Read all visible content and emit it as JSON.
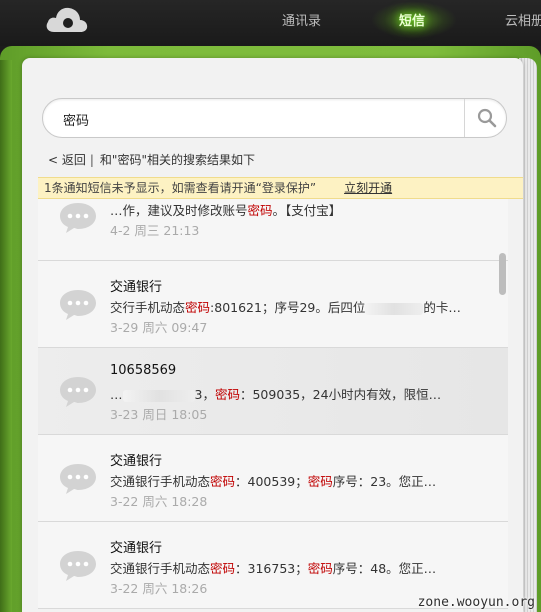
{
  "nav": {
    "items": [
      {
        "label": "通讯录"
      },
      {
        "label": "短信"
      },
      {
        "label": "云相册"
      }
    ],
    "active": "短信"
  },
  "search": {
    "value": "密码"
  },
  "breadcrumb": {
    "back_label": "< 返回",
    "separator": "|",
    "result_text": "和\"密码\"相关的搜索结果如下"
  },
  "notice": {
    "text": "1条通知短信未予显示，如需查看请开通“登录保护”",
    "link_label": "立刻开通"
  },
  "messages": [
    {
      "sender": "",
      "body_pre": "…作，建议及时修改账号",
      "keyword": "密码",
      "body_post": "。【支付宝】",
      "date": "4-2 周三 21:13"
    },
    {
      "sender": "交通银行",
      "body_pre": "交行手机动态",
      "keyword": "密码",
      "body_post": ":801621；序号29。后四位",
      "body_tail": "的卡…",
      "date": "3-29 周六 09:47"
    },
    {
      "sender": "10658569",
      "body_pre": "…",
      "body_mid": "3，",
      "keyword": "密码",
      "body_post": "：509035，24小时内有效，限恒…",
      "date": "3-23 周日 18:05"
    },
    {
      "sender": "交通银行",
      "body_pre": "交通银行手机动态",
      "keyword": "密码",
      "body_mid": "：400539；",
      "keyword2": "密码",
      "body_post": "序号：23。您正…",
      "date": "3-22 周六 18:28"
    },
    {
      "sender": "交通银行",
      "body_pre": "交通银行手机动态",
      "keyword": "密码",
      "body_mid": "：316753；",
      "keyword2": "密码",
      "body_post": "序号：48。您正…",
      "date": "3-22 周六 18:26"
    }
  ],
  "watermark": "zone.wooyun.org",
  "colors": {
    "accent_green": "#7dbb3b",
    "keyword_red": "#c00000",
    "notice_bg": "#fdf2c3"
  }
}
